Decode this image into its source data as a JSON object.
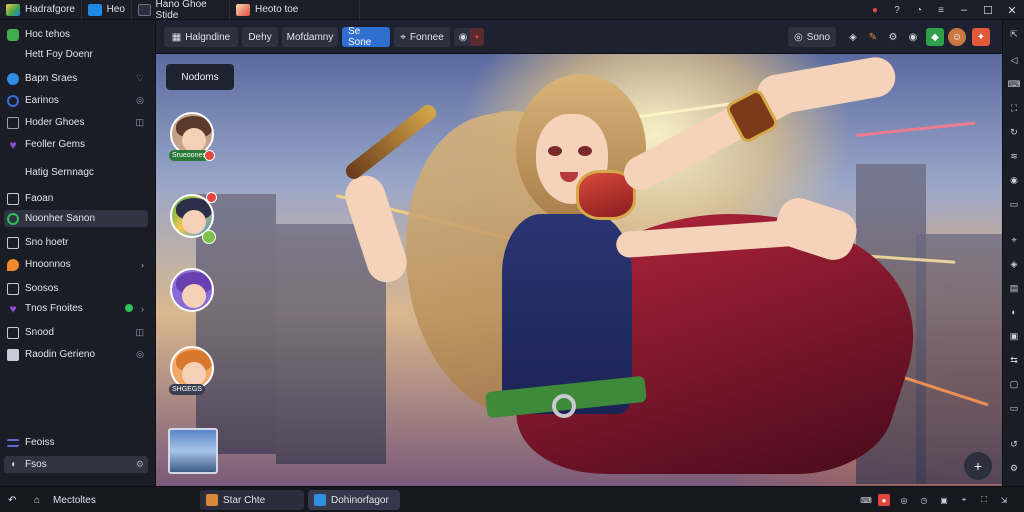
{
  "titlebar": {
    "tabs": [
      {
        "label": "Hadrafgore",
        "color": "#e9b640"
      },
      {
        "label": "Heo",
        "color": "#1e88e5"
      },
      {
        "label": "Hano Ghoe Stide",
        "color": "#2b2e3c"
      },
      {
        "label": "Heoto toe",
        "color": "#e24a4a"
      }
    ]
  },
  "sidebar": {
    "items": [
      {
        "label": "Hoc tehos",
        "icon": "shield-icon",
        "color": "#3fae4a",
        "right": ""
      },
      {
        "label": "Hett Foy Doenr",
        "icon": "",
        "color": "",
        "right": ""
      },
      {
        "label": "Bapn Sraes",
        "icon": "globe-icon",
        "color": "#2e8fe0",
        "right": "♡"
      },
      {
        "label": "Earinos",
        "icon": "circle-icon",
        "color": "#3a6fd8",
        "right": "◎"
      },
      {
        "label": "Hoder Ghoes",
        "icon": "grid-icon",
        "color": "#9aa0b0",
        "right": "◫"
      },
      {
        "label": "Feoller Gems",
        "icon": "heart-icon",
        "color": "#8c4fd8",
        "right": ""
      },
      {
        "label": "Hatig Sernnagc",
        "icon": "",
        "color": "",
        "right": ""
      },
      {
        "label": "Faoan",
        "icon": "book-icon",
        "color": "#c9ccd6",
        "right": ""
      },
      {
        "label": "Noonher Sanon",
        "icon": "check-icon",
        "color": "#2fbf5a",
        "right": "",
        "active": true
      },
      {
        "label": "Sno hoetr",
        "icon": "card-icon",
        "color": "#c9ccd6",
        "right": ""
      },
      {
        "label": "Hnoonnos",
        "icon": "droplet-icon",
        "color": "#f08a2a",
        "right": "›"
      },
      {
        "label": "Soosos",
        "icon": "doc-icon",
        "color": "#c9ccd6",
        "right": ""
      },
      {
        "label": "Tnos Fnoites",
        "icon": "heart-icon",
        "color": "#8c4fd8",
        "right": "›"
      },
      {
        "label": "Snood",
        "icon": "film-icon",
        "color": "#c9ccd6",
        "right": "◫"
      },
      {
        "label": "Raodin Gerieno",
        "icon": "save-icon",
        "color": "#c9ccd6",
        "right": "◎"
      }
    ],
    "footer": [
      {
        "label": "Feoiss",
        "icon": "list-icon"
      },
      {
        "label": "Fsos",
        "icon": "palette-icon"
      }
    ]
  },
  "toolbar": {
    "buttons": [
      {
        "label": "Halgndine",
        "icon": "grid-icon"
      },
      {
        "label": "Dehy"
      },
      {
        "label": "Mofdamny"
      },
      {
        "label": "Se Sone",
        "primary": true
      },
      {
        "label": "Fonnee",
        "icon": "controller-icon"
      }
    ],
    "right_button": {
      "label": "Sono",
      "icon": "camera-icon"
    }
  },
  "game": {
    "nodes_label": "Nodoms",
    "avatars": [
      {
        "label": "Srueoones",
        "hair": "#5a3a2a",
        "dot": "#e0463c"
      },
      {
        "label": "",
        "hair": "#2b2f4a",
        "dot": "#e0463c"
      },
      {
        "label": "",
        "hair": "#6a3fb0",
        "dot": ""
      },
      {
        "label": "SHGEGS",
        "hair": "#d8782f",
        "dot": ""
      }
    ]
  },
  "bottombar": {
    "home_label": "Mectoltes",
    "tasks": [
      {
        "label": "Star Chte",
        "color": "#d9883a"
      },
      {
        "label": "Dohinorfagor",
        "color": "#2e8fe0",
        "active": true
      }
    ]
  }
}
